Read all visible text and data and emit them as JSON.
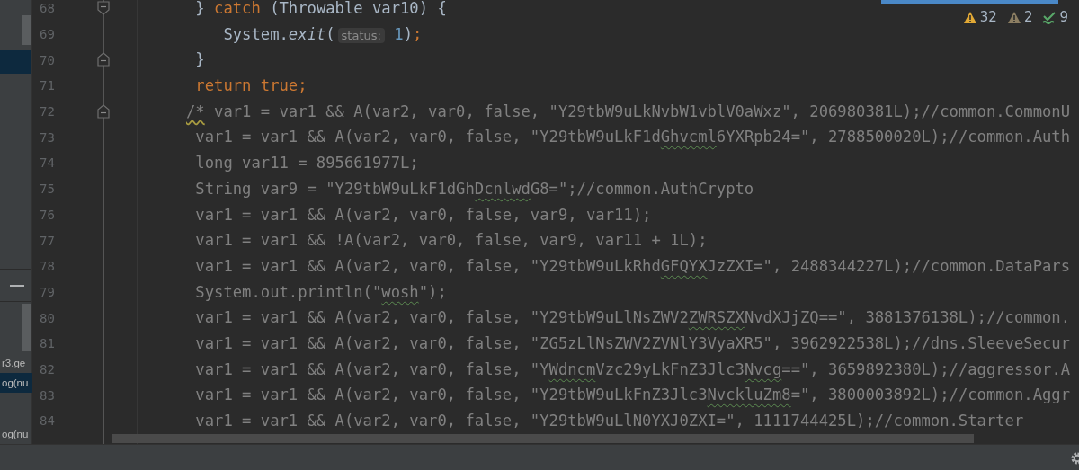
{
  "left_panel": {
    "row_highlighted": true,
    "items": [
      {
        "text": "r3.ge",
        "selected": false
      },
      {
        "text": "og(nu",
        "selected": true
      },
      {
        "text": "og(nu",
        "selected": false
      }
    ]
  },
  "inspections": [
    {
      "kind": "warning",
      "count": "32"
    },
    {
      "kind": "weak_warning",
      "count": "2"
    },
    {
      "kind": "typo",
      "count": "9"
    }
  ],
  "editor": {
    "lines": [
      {
        "number": "68",
        "fold_close": true,
        "tokens": [
          {
            "text": " } ",
            "kind": "plain"
          },
          {
            "text": "catch",
            "kind": "keyword"
          },
          {
            "text": " (Throwable var10) {",
            "kind": "plain"
          }
        ]
      },
      {
        "number": "69",
        "tokens": [
          {
            "text": "    System.",
            "kind": "plain"
          },
          {
            "text": "exit",
            "kind": "italic"
          },
          {
            "text": "(",
            "kind": "plain"
          },
          {
            "text": "status:",
            "kind": "hint"
          },
          {
            "text": " 1",
            "kind": "number"
          },
          {
            "text": ")",
            "kind": "plain"
          },
          {
            "text": ";",
            "kind": "keyword"
          }
        ]
      },
      {
        "number": "70",
        "fold_open": true,
        "tokens": [
          {
            "text": " }",
            "kind": "plain"
          }
        ]
      },
      {
        "number": "71",
        "tokens": [
          {
            "text": " return true;",
            "kind": "keyword"
          }
        ]
      },
      {
        "number": "72",
        "fold_open": true,
        "tokens": [
          {
            "text": "/*",
            "kind": "warn"
          },
          {
            "text": " var1 = var1 && A(var2, var0, false, \"Y29tbW9uLkNvbW1vblV0aWxz\", 206980381L);//common.CommonU",
            "kind": "comment"
          }
        ]
      },
      {
        "number": "73",
        "tokens": [
          {
            "text": " var1 = var1 && A(var2, var0, false, \"Y29tbW9uLkF1d",
            "kind": "comment"
          },
          {
            "text": "Ghvcml",
            "kind": "typo"
          },
          {
            "text": "6YXRpb24=\", 2788500020L);//common.Auth",
            "kind": "comment"
          }
        ]
      },
      {
        "number": "74",
        "tokens": [
          {
            "text": " long var11 = 895661977L;",
            "kind": "comment"
          }
        ]
      },
      {
        "number": "75",
        "tokens": [
          {
            "text": " String var9 = \"Y29tbW9uLkF1dGh",
            "kind": "comment"
          },
          {
            "text": "Dcnlwd",
            "kind": "typo"
          },
          {
            "text": "G8=\";//common.AuthCrypto",
            "kind": "comment"
          }
        ]
      },
      {
        "number": "76",
        "tokens": [
          {
            "text": " var1 = var1 && A(var2, var0, false, var9, var11);",
            "kind": "comment"
          }
        ]
      },
      {
        "number": "77",
        "tokens": [
          {
            "text": " var1 = var1 && !A(var2, var0, false, var9, var11 + 1L);",
            "kind": "comment"
          }
        ]
      },
      {
        "number": "78",
        "tokens": [
          {
            "text": " var1 = var1 && A(var2, var0, false, \"Y29tbW9uLkRhd",
            "kind": "comment"
          },
          {
            "text": "GFQYX",
            "kind": "typo"
          },
          {
            "text": "JzZXI=\", 2488344227L);//common.DataPars",
            "kind": "comment"
          }
        ]
      },
      {
        "number": "79",
        "tokens": [
          {
            "text": " System.out.println(\"",
            "kind": "comment"
          },
          {
            "text": "wosh",
            "kind": "typo"
          },
          {
            "text": "\");",
            "kind": "comment"
          }
        ]
      },
      {
        "number": "80",
        "tokens": [
          {
            "text": " var1 = var1 && A(var2, var0, false, \"Y29tbW9uLlNsZWV2",
            "kind": "comment"
          },
          {
            "text": "ZWRSZX",
            "kind": "typo"
          },
          {
            "text": "NvdXJjZQ==\", 3881376138L);//common.",
            "kind": "comment"
          }
        ]
      },
      {
        "number": "81",
        "tokens": [
          {
            "text": " var1 = var1 && A(var2, var0, false, \"ZG5zLlNsZWV2ZVNlY3VyaXR5\", 3962922538L);//dns.SleeveSecur",
            "kind": "comment"
          }
        ]
      },
      {
        "number": "82",
        "tokens": [
          {
            "text": " var1 = var1 && A(var2, var0, false, \"Y",
            "kind": "comment"
          },
          {
            "text": "Wdncm",
            "kind": "typo"
          },
          {
            "text": "Vzc29yLkFnZ3Jlc3",
            "kind": "comment"
          },
          {
            "text": "Nvcg",
            "kind": "typo"
          },
          {
            "text": "==\", 3659892380L);//aggressor.A",
            "kind": "comment"
          }
        ]
      },
      {
        "number": "83",
        "tokens": [
          {
            "text": " var1 = var1 && A(var2, var0, false, \"Y29tbW9uLkFnZ3Jlc3",
            "kind": "comment"
          },
          {
            "text": "NvckluZm8",
            "kind": "typo"
          },
          {
            "text": "=\", 3800003892L);//common.Aggr",
            "kind": "comment"
          }
        ]
      },
      {
        "number": "84",
        "tokens": [
          {
            "text": " var1 = var1 && A(var2, var0, false, \"Y29tbW9uLlN0YXJ0ZXI=\", 1111744425L);//common.Starter",
            "kind": "comment"
          }
        ]
      }
    ]
  }
}
